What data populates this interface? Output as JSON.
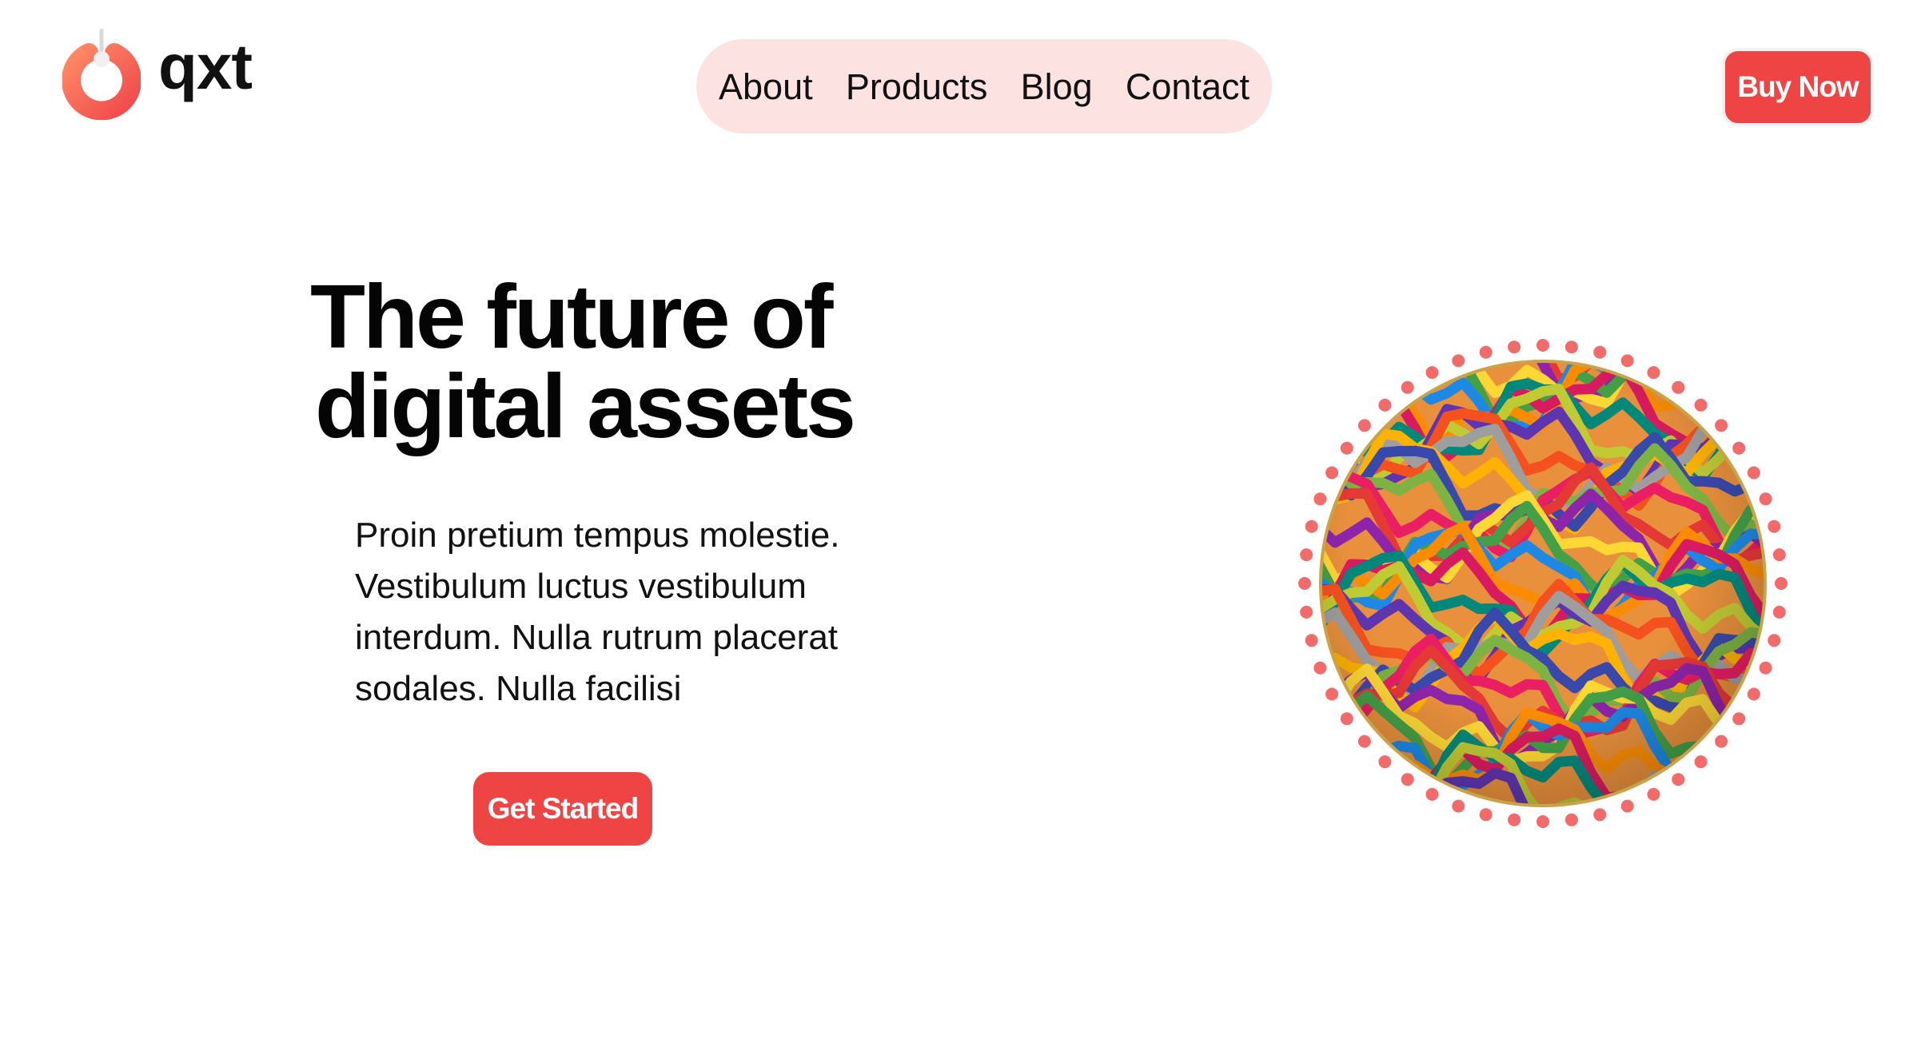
{
  "brand": {
    "name": "qxt",
    "logo_icon": "power-ring-icon"
  },
  "nav": {
    "items": [
      {
        "label": "About"
      },
      {
        "label": "Products"
      },
      {
        "label": "Blog"
      },
      {
        "label": "Contact"
      }
    ]
  },
  "header": {
    "buy_label": "Buy Now"
  },
  "hero": {
    "title_line1": "The future of",
    "title_line2": "digital assets",
    "body": "Proin pretium tempus molestie. Vestibulum luctus vestibulum interdum. Nulla rutrum placerat sodales. Nulla facilisi",
    "cta_label": "Get Started",
    "image": "marbled-sphere-image"
  },
  "colors": {
    "accent": "#ef4444",
    "nav_background": "#fde2e2",
    "dots": "#f26b6b"
  }
}
